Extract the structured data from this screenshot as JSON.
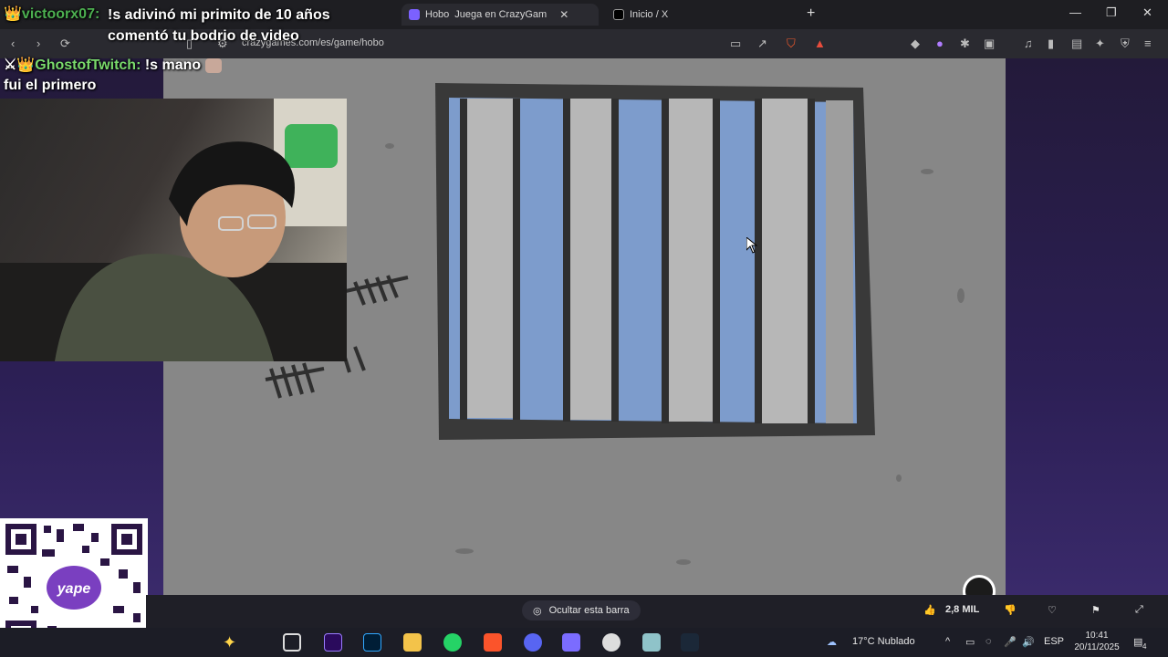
{
  "browser": {
    "tabs": [
      {
        "label": "Hobo",
        "sub": "Juega en CrazyGam",
        "active": true
      },
      {
        "label": "Inicio / X",
        "active": false
      }
    ],
    "url": "crazygames.com/es/game/hobo"
  },
  "chat": [
    {
      "user": "victoorx07:",
      "message": "!s adivinó mi primito de 10 años comentó tu bodrio de video"
    },
    {
      "user": "GhostofTwitch:",
      "message": "!s mano",
      "message2": "fui el primero"
    }
  ],
  "game_bar": {
    "hide_label": "Ocultar esta barra",
    "likes": "2,8 MIL"
  },
  "taskbar": {
    "weather": "17°C  Nublado",
    "lang": "ESP",
    "time": "10:41",
    "date": "20/11/2025",
    "notifications": "4"
  },
  "colors": {
    "accent_purple": "#3a2a6b",
    "sky_blue": "#7d9ccc",
    "bar_dark": "#2f2f2f"
  }
}
